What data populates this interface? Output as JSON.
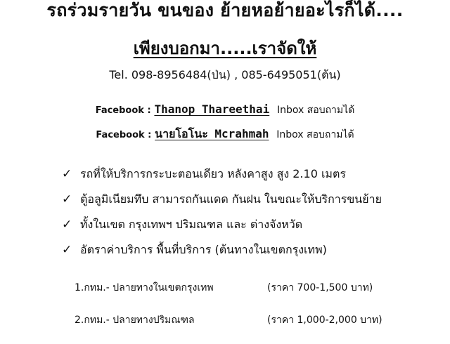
{
  "header": {
    "title": "รถร่วมรายวัน ขนของ ย้ายหอย้ายอะไรก็ได้....",
    "subtitle": "เพียงบอกมา.....เราจัดให้"
  },
  "contact": {
    "tel": "Tel. 098-8956484(ป่น) , 085-6495051(ต้น)"
  },
  "facebook": [
    {
      "label": "Facebook :",
      "name": "Thanop Thareethai",
      "inbox": "Inbox สอบถามได้"
    },
    {
      "label": "Facebook :",
      "name": "นายโอโนะ Mcrahmah",
      "inbox": "Inbox สอบถามได้"
    }
  ],
  "checklist": [
    "รถที่ให้บริการกระบะตอนเดียว หลังคาสูง สูง 2.10 เมตร",
    "ตู้อลูมิเนียมทึบ สามารถกันแดด กันฝน  ในขณะให้บริการขนย้าย",
    "ทั้งในเขต กรุงเทพฯ ปริมณฑล และ ต่างจังหวัด",
    "อัตราค่าบริการ พื้นที่บริการ (ต้นทางในเขตกรุงเทพ)"
  ],
  "check_icon": "check-icon",
  "pricing": [
    {
      "route": "1.กทม.- ปลายทางในเขตกรุงเทพ",
      "price": "(ราคา 700-1,500 บาท)"
    },
    {
      "route": "2.กทม.- ปลายทางปริมณฑล",
      "price": "(ราคา 1,000-2,000 บาท)"
    }
  ]
}
